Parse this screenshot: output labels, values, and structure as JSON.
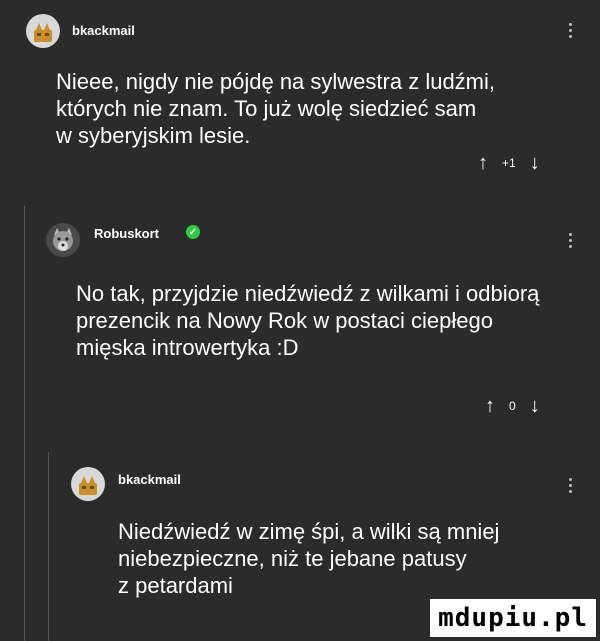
{
  "comments": [
    {
      "username": "bkackmail",
      "text_lines": [
        "Nieee, nigdy nie pójdę na sylwestra z ludźmi,",
        "których nie znam. To już wolę siedzieć sam",
        "w syberyjskim lesie."
      ],
      "score": "+1",
      "avatar_icon": "cat-avatar-icon"
    },
    {
      "username": "Robuskort",
      "verified": "✓",
      "text_lines": [
        "No tak, przyjdzie niedźwiedź z wilkami i odbiorą",
        "prezencik na Nowy Rok w postaci ciepłego",
        "mięska introwertyka :D"
      ],
      "score": "0",
      "avatar_icon": "wolf-avatar-icon"
    },
    {
      "username": "bkackmail",
      "text_lines": [
        "Niedźwiedź w zimę śpi, a wilki są mniej",
        "niebezpieczne, niż te jebane patusy",
        "z petardami"
      ],
      "avatar_icon": "cat-avatar-icon"
    }
  ],
  "arrows": {
    "up": "↑",
    "down": "↓"
  },
  "watermark": "mdupiu.pl",
  "colors": {
    "background": "#2b2b2b",
    "text": "#ffffff",
    "verified": "#2ecc40"
  }
}
